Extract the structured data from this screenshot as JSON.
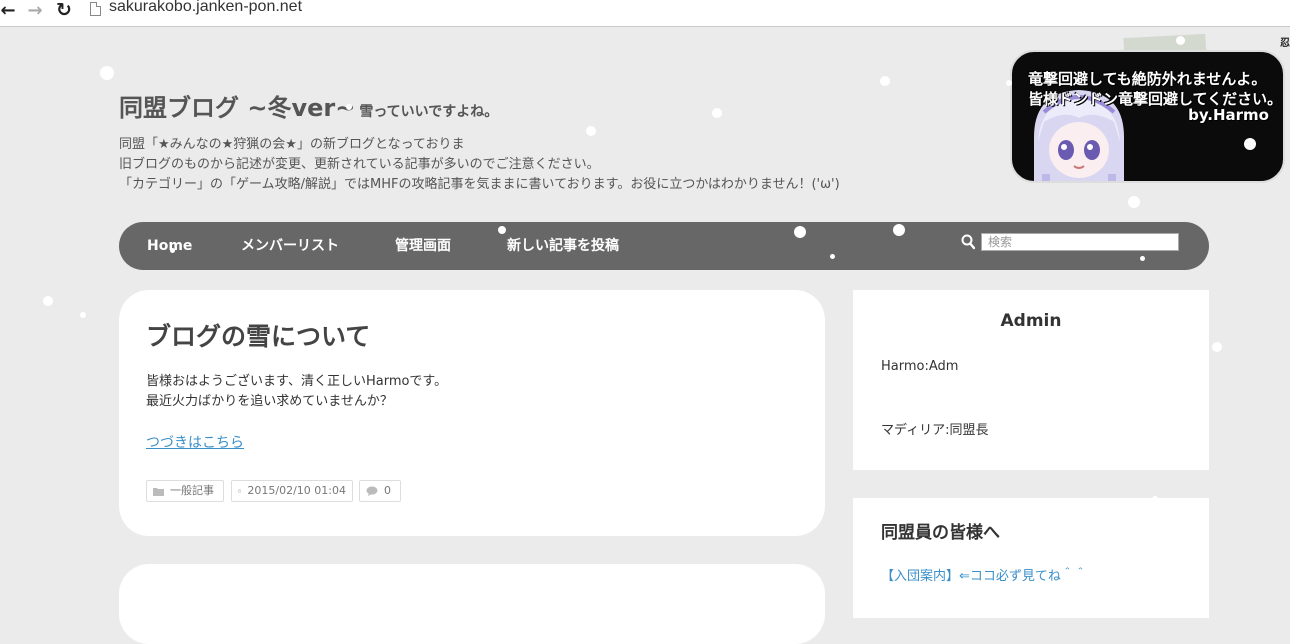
{
  "browser": {
    "back_glyph": "←",
    "forward_glyph": "→",
    "reload_glyph": "↻",
    "url": "sakurakobo.janken-pon.net"
  },
  "corner_glyph": "忍",
  "header": {
    "title": "同盟ブログ ~冬ver~",
    "tagline": "雪っていいですよね。",
    "description": [
      "同盟「★みんなの★狩猟の会★」の新ブログとなっておりま",
      "旧ブログのものから記述が変更、更新されている記事が多いのでご注意ください。",
      "「カテゴリー」の「ゲーム攻略/解説」ではMHFの攻略記事を気ままに書いております。お役に立つかはわかりません！('ω')"
    ]
  },
  "banner": {
    "line1": "竜撃回避しても絶防外れませんよ。",
    "line2": "皆様ドンドン竜撃回避してください。",
    "line3": "by.Harmo"
  },
  "nav": {
    "items": [
      "Home",
      "メンバーリスト",
      "管理画面",
      "新しい記事を投稿"
    ],
    "search_placeholder": "検索"
  },
  "post": {
    "title": "ブログの雪について",
    "body": [
      "皆様おはようございます、清く正しいHarmoです。",
      "最近火力ばかりを追い求めていませんか？"
    ],
    "read_more": "つづきはこちら",
    "category": "一般記事",
    "date": "2015/02/10 01:04",
    "comments": "0"
  },
  "sidebar": {
    "admin": {
      "title": "Admin",
      "lines": [
        "Harmo:Adm",
        "マディリア:同盟長"
      ]
    },
    "members": {
      "title": "同盟員の皆様へ",
      "link": "【入団案内】⇐ココ必ず見てね＾＾"
    }
  },
  "colors": {
    "background": "#ebebeb",
    "navbar": "#676767",
    "link": "#3a8fc9",
    "card": "#ffffff"
  }
}
